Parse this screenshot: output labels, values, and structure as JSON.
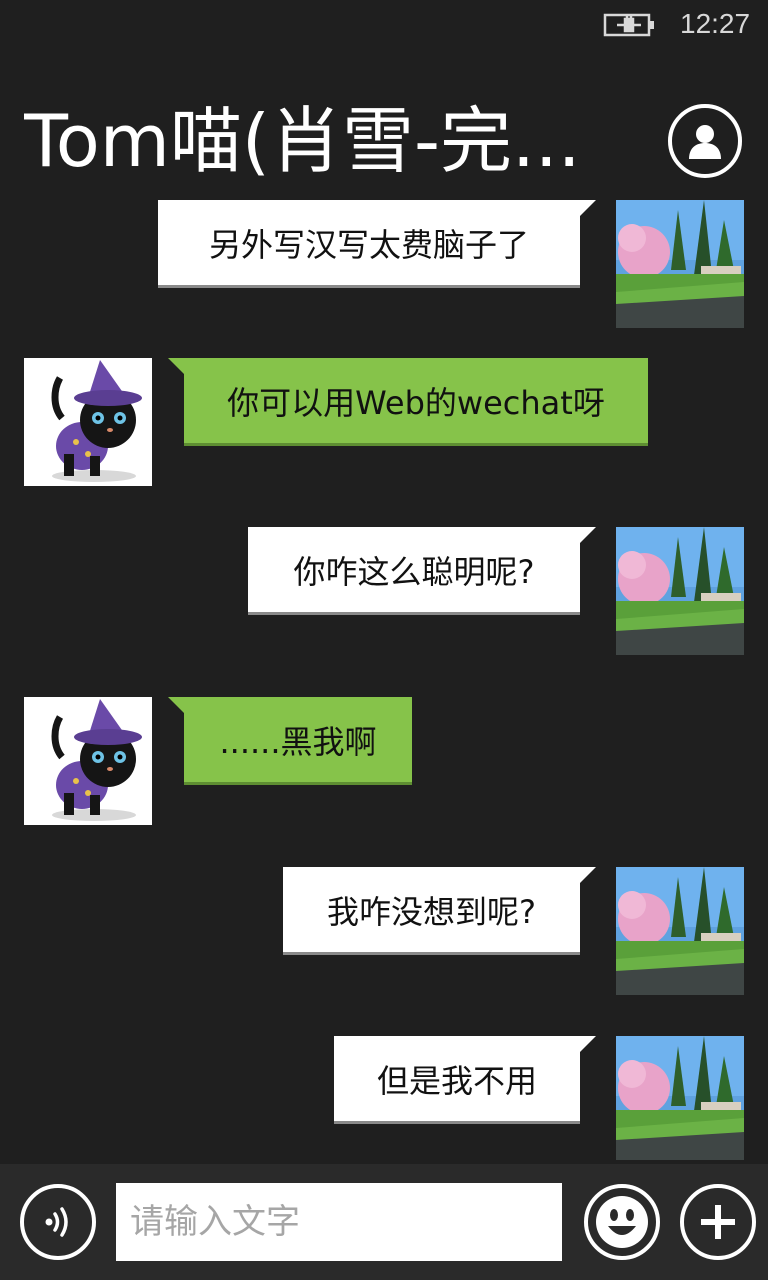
{
  "status_bar": {
    "time": "12:27",
    "battery_icon": "battery-charging-icon"
  },
  "header": {
    "title": "Tom喵(肖雪-完...",
    "profile_icon": "person-icon"
  },
  "messages": [
    {
      "direction": "out",
      "text": "另外写汉写太费脑子了",
      "avatar": "landscape-avatar"
    },
    {
      "direction": "in",
      "text": "你可以用Web的wechat呀",
      "avatar": "black-cat-avatar"
    },
    {
      "direction": "out",
      "text": "你咋这么聪明呢?",
      "avatar": "landscape-avatar"
    },
    {
      "direction": "in",
      "text": "......黑我啊",
      "avatar": "black-cat-avatar"
    },
    {
      "direction": "out",
      "text": "我咋没想到呢?",
      "avatar": "landscape-avatar"
    },
    {
      "direction": "out",
      "text": "但是我不用",
      "avatar": "landscape-avatar"
    }
  ],
  "input_bar": {
    "placeholder": "请输入文字",
    "voice_icon": "voice-icon",
    "emoji_icon": "smiley-icon",
    "add_icon": "plus-icon"
  },
  "colors": {
    "background": "#1f1f1f",
    "incoming_bubble": "#86c34a",
    "outgoing_bubble": "#ffffff"
  }
}
